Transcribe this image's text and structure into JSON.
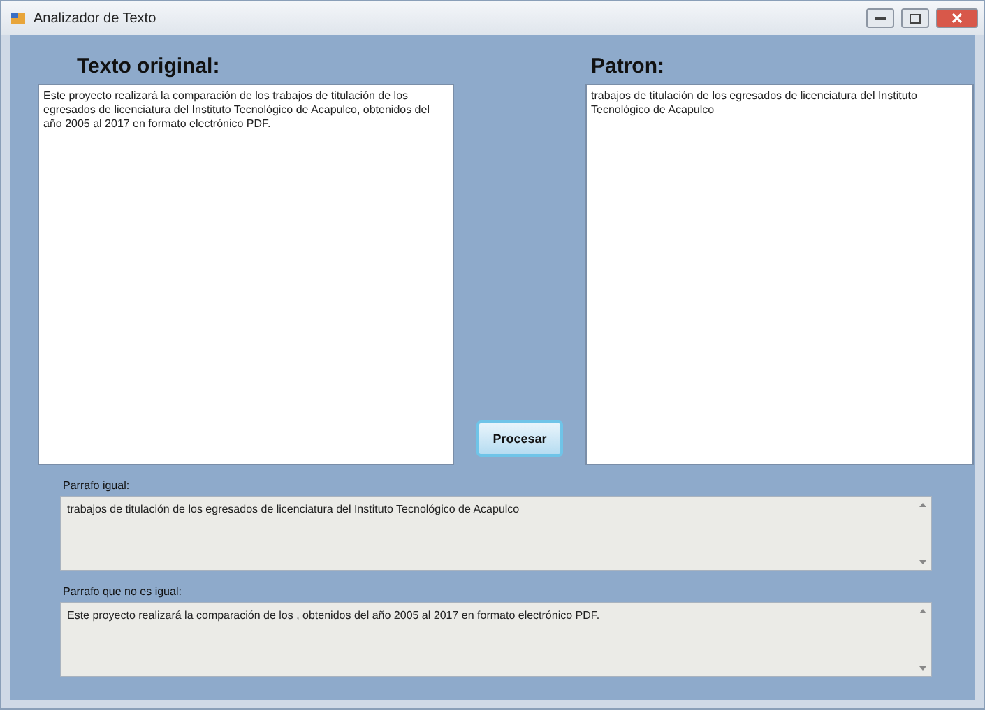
{
  "window": {
    "title": "Analizador de Texto"
  },
  "original": {
    "label": "Texto original:",
    "value": "Este proyecto realizará la comparación de los trabajos de titulación de los egresados de licenciatura del Instituto Tecnológico de Acapulco, obtenidos del año 2005 al 2017 en formato electrónico PDF."
  },
  "pattern": {
    "label": "Patron:",
    "value": "trabajos de titulación de los egresados de licenciatura del Instituto Tecnológico de Acapulco"
  },
  "button": "Procesar",
  "results": [
    {
      "label": "Parrafo igual:",
      "value": "trabajos de titulación de los egresados de licenciatura del Instituto Tecnológico de Acapulco"
    },
    {
      "label": "Parrafo que no es igual:",
      "value": "Este proyecto realizará la comparación de los , obtenidos del año 2005 al 2017 en formato electrónico PDF."
    }
  ]
}
